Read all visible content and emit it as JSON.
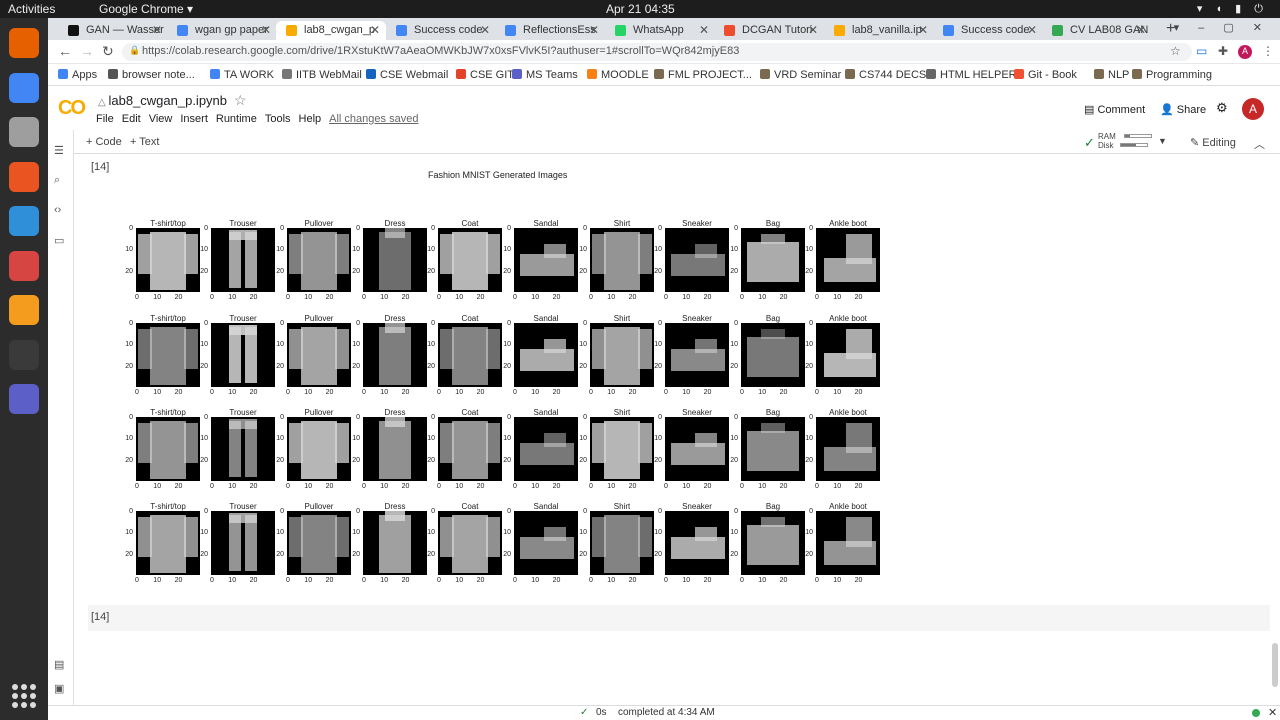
{
  "os": {
    "activities": "Activities",
    "app_menu": "Google Chrome ▾",
    "clock": "Apr 21  04:35",
    "dock": [
      {
        "name": "firefox-icon",
        "color": "#e66000"
      },
      {
        "name": "chrome-icon",
        "color": "#4285f4"
      },
      {
        "name": "files-icon",
        "color": "#9e9e9e"
      },
      {
        "name": "software-center-icon",
        "color": "#e95420"
      },
      {
        "name": "help-icon",
        "color": "#2f8fd8"
      },
      {
        "name": "document-viewer-icon",
        "color": "#d64541"
      },
      {
        "name": "sublime-text-icon",
        "color": "#f49c1e"
      },
      {
        "name": "terminal-icon",
        "color": "#3a3a3a"
      },
      {
        "name": "teams-icon",
        "color": "#5b5fc7"
      }
    ]
  },
  "browser": {
    "tabs": [
      {
        "label": "GAN — Wasser",
        "fav": "#111111"
      },
      {
        "label": "wgan gp paper",
        "fav": "#4285f4"
      },
      {
        "label": "lab8_cwgan_p",
        "fav": "#f9ab00",
        "active": true
      },
      {
        "label": "Success code",
        "fav": "#4285f4"
      },
      {
        "label": "ReflectionsEss",
        "fav": "#4285f4"
      },
      {
        "label": "WhatsApp",
        "fav": "#25d366"
      },
      {
        "label": "DCGAN Tutori",
        "fav": "#ee4c2c"
      },
      {
        "label": "lab8_vanilla.ip",
        "fav": "#f9ab00"
      },
      {
        "label": "Success code",
        "fav": "#4285f4"
      },
      {
        "label": "CV LAB08 GAN",
        "fav": "#34a853"
      }
    ],
    "url": "https://colab.research.google.com/drive/1RXstuKtW7aAeaOMWKbJW7x0xsFVlvK5I?authuser=1#scrollTo=WQr842mjyE83",
    "bookmarks": [
      {
        "label": "Apps",
        "color": "#4285f4"
      },
      {
        "label": "browser note...",
        "color": "#555555"
      },
      {
        "label": "TA WORK",
        "color": "#4285f4"
      },
      {
        "label": "IITB WebMail",
        "color": "#777777"
      },
      {
        "label": "CSE Webmail",
        "color": "#1565c0"
      },
      {
        "label": "CSE GIT",
        "color": "#e24329"
      },
      {
        "label": "MS Teams",
        "color": "#5b5fc7"
      },
      {
        "label": "MOODLE",
        "color": "#f98012"
      },
      {
        "label": "FML PROJECT...",
        "color": "#7a6a4f"
      },
      {
        "label": "VRD Seminar",
        "color": "#7a6a4f"
      },
      {
        "label": "CS744 DECS",
        "color": "#7a6a4f"
      },
      {
        "label": "HTML HELPER",
        "color": "#666666"
      },
      {
        "label": "Git - Book",
        "color": "#f05133"
      },
      {
        "label": "NLP",
        "color": "#7a6a4f"
      },
      {
        "label": "Programming",
        "color": "#7a6a4f"
      }
    ]
  },
  "colab": {
    "filename": "lab8_cwgan_p.ipynb",
    "menus": [
      "File",
      "Edit",
      "View",
      "Insert",
      "Runtime",
      "Tools",
      "Help"
    ],
    "saved": "All changes saved",
    "comment": "Comment",
    "share": "Share",
    "avatar": "A",
    "add_code": "+ Code",
    "add_text": "+ Text",
    "ram": "RAM",
    "disk": "Disk",
    "ram_usage": 0.2,
    "disk_usage": 0.6,
    "editing": "Editing",
    "cell_prompt": "[14]",
    "empty_cell_prompt": "[14]",
    "status_duration": "0s",
    "status_text": "completed at 4:34 AM"
  },
  "figure": {
    "title": "Fashion MNIST Generated Images",
    "labels": [
      "T-shirt/top",
      "Trouser",
      "Pullover",
      "Dress",
      "Coat",
      "Sandal",
      "Shirt",
      "Sneaker",
      "Bag",
      "Ankle boot"
    ],
    "rows": 4,
    "ytick_labels": [
      "0",
      "10",
      "20"
    ],
    "xtick_labels": [
      "0",
      "10",
      "20"
    ]
  }
}
